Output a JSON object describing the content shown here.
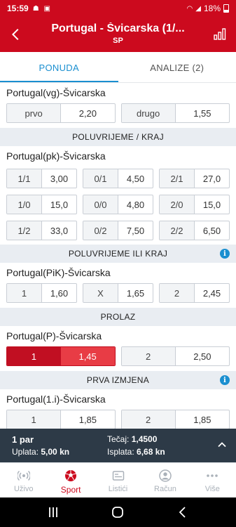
{
  "status": {
    "time": "15:59",
    "battery": "18%"
  },
  "header": {
    "title": "Portugal - Švicarska (1/...",
    "subtitle": "SP"
  },
  "tabs": [
    {
      "label": "PONUDA"
    },
    {
      "label": "ANALIZE (2)"
    }
  ],
  "markets": {
    "m1": {
      "title": "Portugal(vg)-Švicarska",
      "odds": [
        {
          "label": "prvo",
          "value": "2,20"
        },
        {
          "label": "drugo",
          "value": "1,55"
        }
      ]
    },
    "h1": {
      "label": "POLUVRIJEME / KRAJ"
    },
    "m2": {
      "title": "Portugal(pk)-Švicarska",
      "odds": [
        {
          "label": "1/1",
          "value": "3,00"
        },
        {
          "label": "0/1",
          "value": "4,50"
        },
        {
          "label": "2/1",
          "value": "27,0"
        },
        {
          "label": "1/0",
          "value": "15,0"
        },
        {
          "label": "0/0",
          "value": "4,80"
        },
        {
          "label": "2/0",
          "value": "15,0"
        },
        {
          "label": "1/2",
          "value": "33,0"
        },
        {
          "label": "0/2",
          "value": "7,50"
        },
        {
          "label": "2/2",
          "value": "6,50"
        }
      ]
    },
    "h2": {
      "label": "POLUVRIJEME ILI KRAJ"
    },
    "m3": {
      "title": "Portugal(PiK)-Švicarska",
      "odds": [
        {
          "label": "1",
          "value": "1,60"
        },
        {
          "label": "X",
          "value": "1,65"
        },
        {
          "label": "2",
          "value": "2,45"
        }
      ]
    },
    "h3": {
      "label": "PROLAZ"
    },
    "m4": {
      "title": "Portugal(P)-Švicarska",
      "odds": [
        {
          "label": "1",
          "value": "1,45",
          "selected": true
        },
        {
          "label": "2",
          "value": "2,50"
        }
      ]
    },
    "h4": {
      "label": "PRVA IZMJENA"
    },
    "m5": {
      "title": "Portugal(1.i)-Švicarska",
      "odds": [
        {
          "label": "1",
          "value": "1,85"
        },
        {
          "label": "2",
          "value": "1,85"
        }
      ]
    }
  },
  "betslip": {
    "pairs": "1 par",
    "uplata_label": "Uplata:",
    "uplata_value": "5,00 kn",
    "tecaj_label": "Tečaj:",
    "tecaj_value": "1,4500",
    "isplata_label": "Isplata:",
    "isplata_value": "6,68 kn"
  },
  "bottomnav": [
    {
      "label": "Uživo",
      "icon": "live-icon"
    },
    {
      "label": "Sport",
      "icon": "football-icon"
    },
    {
      "label": "Listići",
      "icon": "ticket-icon"
    },
    {
      "label": "Račun",
      "icon": "user-icon"
    },
    {
      "label": "Više",
      "icon": "more-icon"
    }
  ],
  "colors": {
    "brand": "#cc0a1e",
    "accent": "#1a8fd0",
    "selected": "#e83c45",
    "slip": "#2d3a47"
  }
}
